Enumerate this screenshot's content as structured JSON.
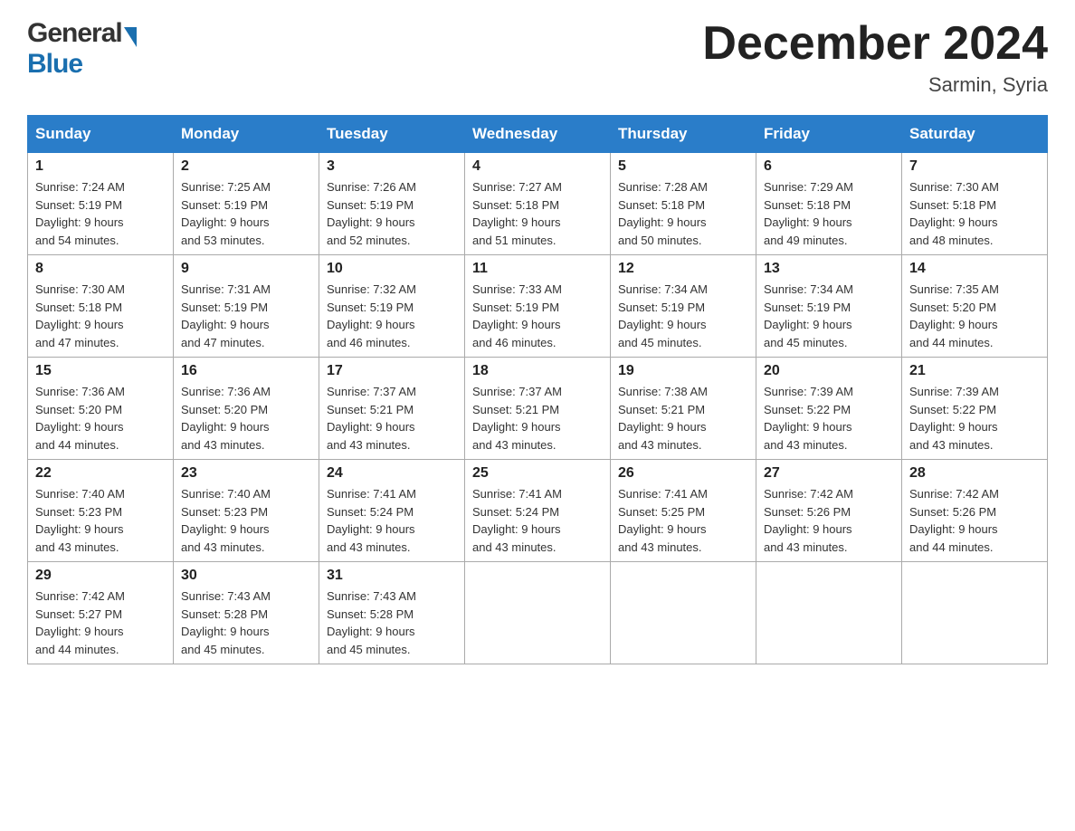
{
  "header": {
    "logo_general": "General",
    "logo_blue": "Blue",
    "month_title": "December 2024",
    "location": "Sarmin, Syria"
  },
  "days_of_week": [
    "Sunday",
    "Monday",
    "Tuesday",
    "Wednesday",
    "Thursday",
    "Friday",
    "Saturday"
  ],
  "weeks": [
    [
      {
        "day": "1",
        "sunrise": "7:24 AM",
        "sunset": "5:19 PM",
        "daylight": "9 hours and 54 minutes."
      },
      {
        "day": "2",
        "sunrise": "7:25 AM",
        "sunset": "5:19 PM",
        "daylight": "9 hours and 53 minutes."
      },
      {
        "day": "3",
        "sunrise": "7:26 AM",
        "sunset": "5:19 PM",
        "daylight": "9 hours and 52 minutes."
      },
      {
        "day": "4",
        "sunrise": "7:27 AM",
        "sunset": "5:18 PM",
        "daylight": "9 hours and 51 minutes."
      },
      {
        "day": "5",
        "sunrise": "7:28 AM",
        "sunset": "5:18 PM",
        "daylight": "9 hours and 50 minutes."
      },
      {
        "day": "6",
        "sunrise": "7:29 AM",
        "sunset": "5:18 PM",
        "daylight": "9 hours and 49 minutes."
      },
      {
        "day": "7",
        "sunrise": "7:30 AM",
        "sunset": "5:18 PM",
        "daylight": "9 hours and 48 minutes."
      }
    ],
    [
      {
        "day": "8",
        "sunrise": "7:30 AM",
        "sunset": "5:18 PM",
        "daylight": "9 hours and 47 minutes."
      },
      {
        "day": "9",
        "sunrise": "7:31 AM",
        "sunset": "5:19 PM",
        "daylight": "9 hours and 47 minutes."
      },
      {
        "day": "10",
        "sunrise": "7:32 AM",
        "sunset": "5:19 PM",
        "daylight": "9 hours and 46 minutes."
      },
      {
        "day": "11",
        "sunrise": "7:33 AM",
        "sunset": "5:19 PM",
        "daylight": "9 hours and 46 minutes."
      },
      {
        "day": "12",
        "sunrise": "7:34 AM",
        "sunset": "5:19 PM",
        "daylight": "9 hours and 45 minutes."
      },
      {
        "day": "13",
        "sunrise": "7:34 AM",
        "sunset": "5:19 PM",
        "daylight": "9 hours and 45 minutes."
      },
      {
        "day": "14",
        "sunrise": "7:35 AM",
        "sunset": "5:20 PM",
        "daylight": "9 hours and 44 minutes."
      }
    ],
    [
      {
        "day": "15",
        "sunrise": "7:36 AM",
        "sunset": "5:20 PM",
        "daylight": "9 hours and 44 minutes."
      },
      {
        "day": "16",
        "sunrise": "7:36 AM",
        "sunset": "5:20 PM",
        "daylight": "9 hours and 43 minutes."
      },
      {
        "day": "17",
        "sunrise": "7:37 AM",
        "sunset": "5:21 PM",
        "daylight": "9 hours and 43 minutes."
      },
      {
        "day": "18",
        "sunrise": "7:37 AM",
        "sunset": "5:21 PM",
        "daylight": "9 hours and 43 minutes."
      },
      {
        "day": "19",
        "sunrise": "7:38 AM",
        "sunset": "5:21 PM",
        "daylight": "9 hours and 43 minutes."
      },
      {
        "day": "20",
        "sunrise": "7:39 AM",
        "sunset": "5:22 PM",
        "daylight": "9 hours and 43 minutes."
      },
      {
        "day": "21",
        "sunrise": "7:39 AM",
        "sunset": "5:22 PM",
        "daylight": "9 hours and 43 minutes."
      }
    ],
    [
      {
        "day": "22",
        "sunrise": "7:40 AM",
        "sunset": "5:23 PM",
        "daylight": "9 hours and 43 minutes."
      },
      {
        "day": "23",
        "sunrise": "7:40 AM",
        "sunset": "5:23 PM",
        "daylight": "9 hours and 43 minutes."
      },
      {
        "day": "24",
        "sunrise": "7:41 AM",
        "sunset": "5:24 PM",
        "daylight": "9 hours and 43 minutes."
      },
      {
        "day": "25",
        "sunrise": "7:41 AM",
        "sunset": "5:24 PM",
        "daylight": "9 hours and 43 minutes."
      },
      {
        "day": "26",
        "sunrise": "7:41 AM",
        "sunset": "5:25 PM",
        "daylight": "9 hours and 43 minutes."
      },
      {
        "day": "27",
        "sunrise": "7:42 AM",
        "sunset": "5:26 PM",
        "daylight": "9 hours and 43 minutes."
      },
      {
        "day": "28",
        "sunrise": "7:42 AM",
        "sunset": "5:26 PM",
        "daylight": "9 hours and 44 minutes."
      }
    ],
    [
      {
        "day": "29",
        "sunrise": "7:42 AM",
        "sunset": "5:27 PM",
        "daylight": "9 hours and 44 minutes."
      },
      {
        "day": "30",
        "sunrise": "7:43 AM",
        "sunset": "5:28 PM",
        "daylight": "9 hours and 45 minutes."
      },
      {
        "day": "31",
        "sunrise": "7:43 AM",
        "sunset": "5:28 PM",
        "daylight": "9 hours and 45 minutes."
      },
      null,
      null,
      null,
      null
    ]
  ],
  "labels": {
    "sunrise": "Sunrise:",
    "sunset": "Sunset:",
    "daylight": "Daylight:"
  }
}
